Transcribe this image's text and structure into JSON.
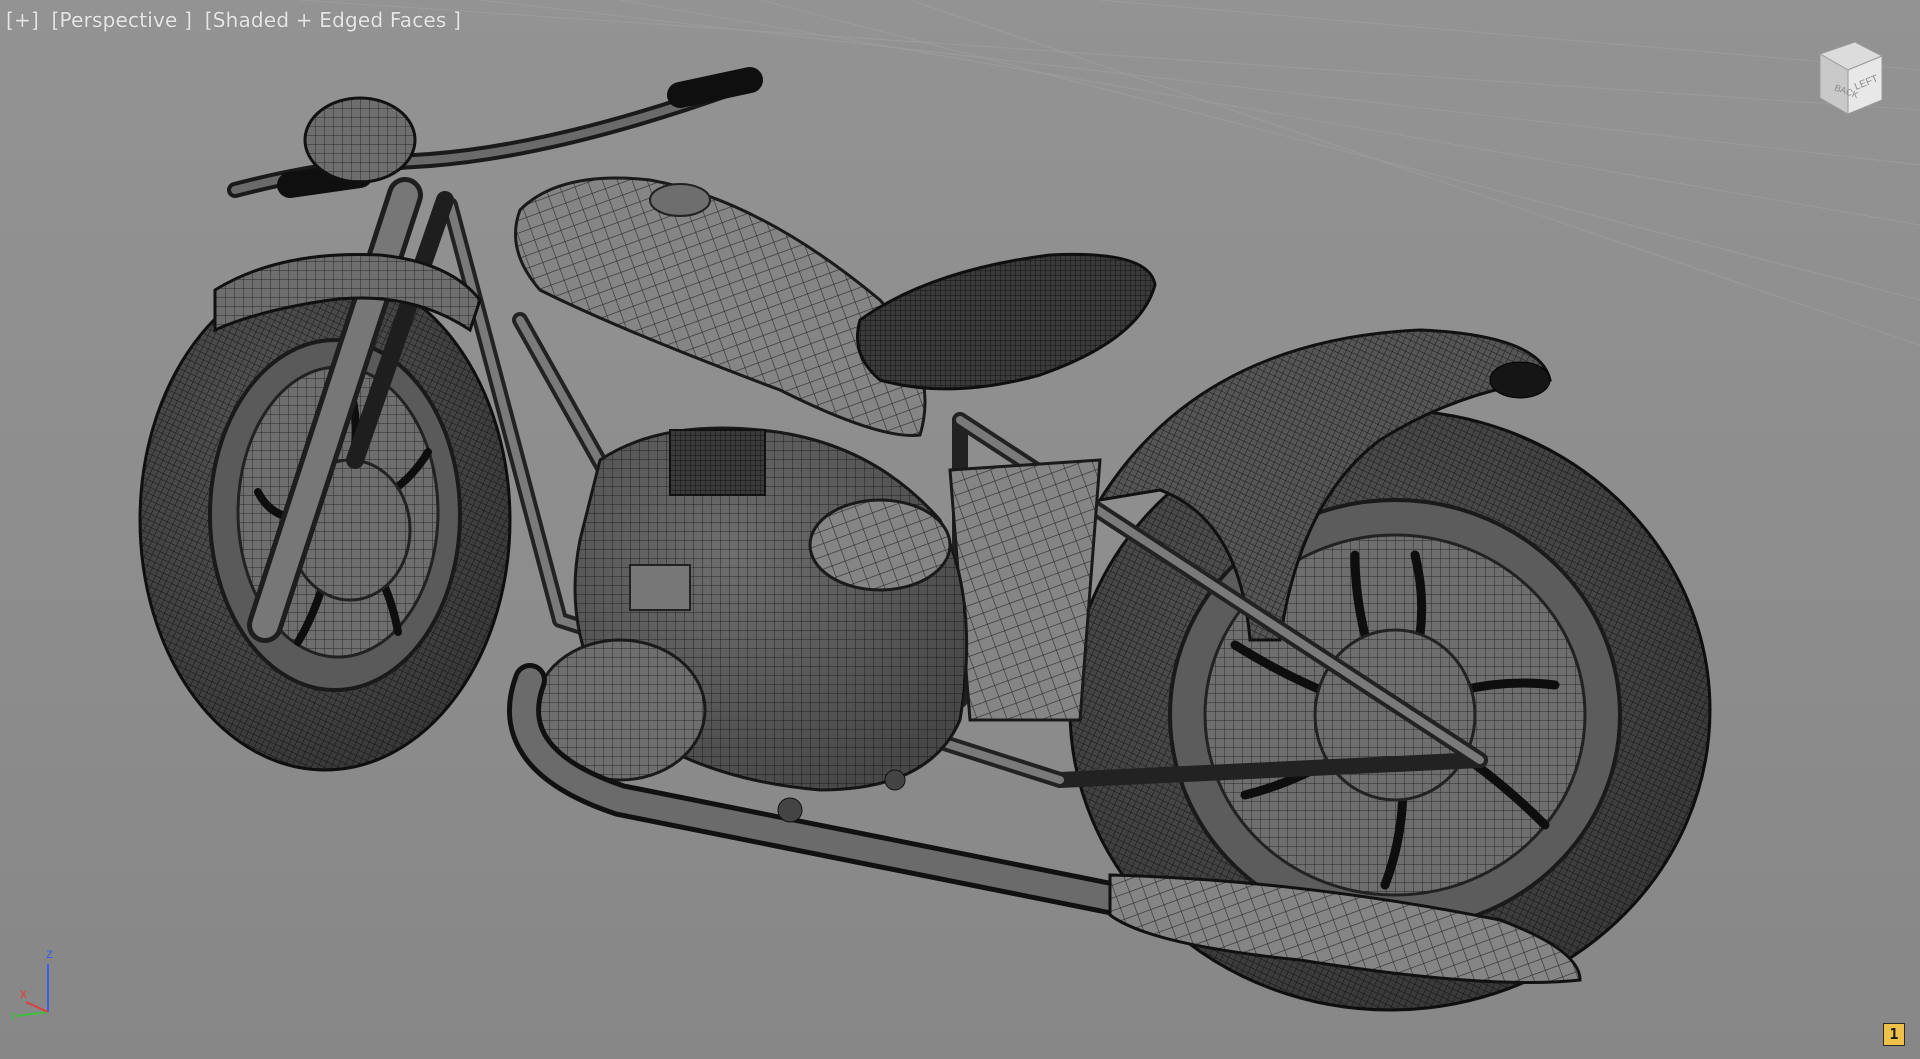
{
  "viewport": {
    "menu_label": "[+]",
    "view_label": "[Perspective ]",
    "shading_label": "[Shaded + Edged Faces ]",
    "background_color": "#8c8c8c",
    "model_subject": "motorcycle wireframe mesh"
  },
  "viewcube": {
    "face_front": "LEFT",
    "face_side": "BACK",
    "icon": "viewcube-icon"
  },
  "axis_tripod": {
    "x_label": "x",
    "y_label": "y",
    "z_label": "z",
    "x_color": "#e23c3c",
    "y_color": "#3fbf3f",
    "z_color": "#3c5fe2"
  },
  "viewport_number": "1"
}
